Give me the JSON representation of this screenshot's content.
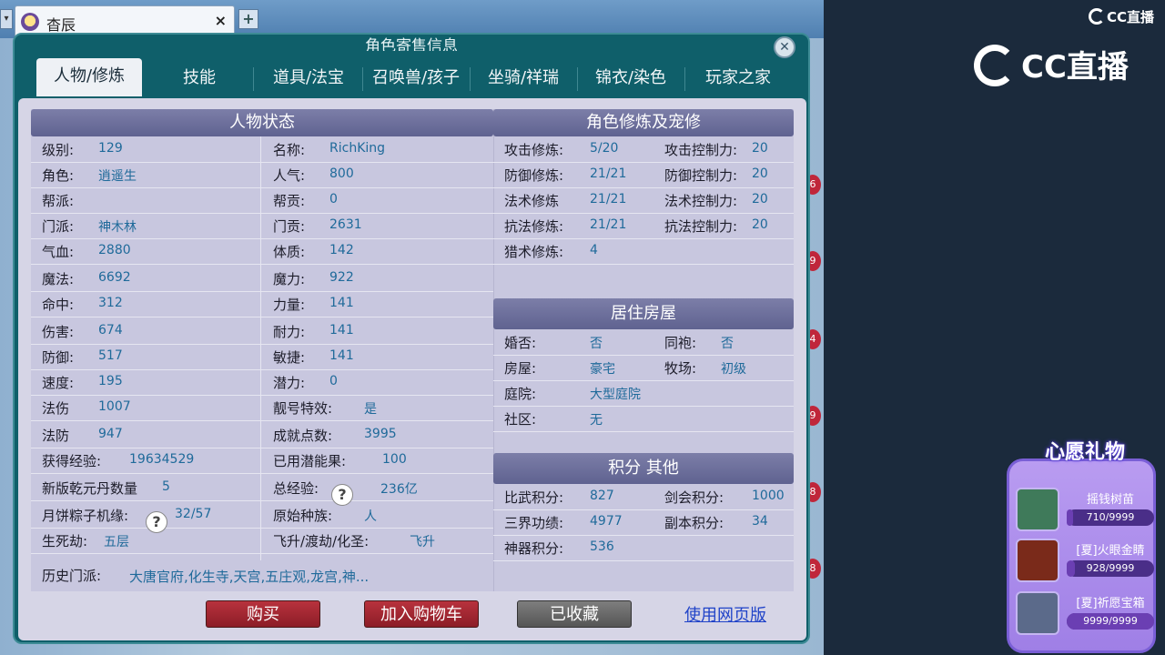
{
  "browser": {
    "tab_title": "杳辰",
    "tab_close": "×",
    "new_tab": "+",
    "tab_scroll": "▾"
  },
  "dialog": {
    "title": "角色寄售信息",
    "close": "✕",
    "tabs": [
      "人物/修炼",
      "技能",
      "道具/法宝",
      "召唤兽/孩子",
      "坐骑/祥瑞",
      "锦衣/染色",
      "玩家之家"
    ]
  },
  "status": {
    "heading": "人物状态",
    "left": [
      {
        "label": "级别:",
        "value": "129"
      },
      {
        "label": "角色:",
        "value": "逍遥生"
      },
      {
        "label": "帮派:",
        "value": ""
      },
      {
        "label": "门派:",
        "value": "神木林"
      },
      {
        "label": "气血:",
        "value": "2880"
      },
      {
        "label": "魔法:",
        "value": "6692"
      },
      {
        "label": "命中:",
        "value": "312"
      },
      {
        "label": "伤害:",
        "value": "674"
      },
      {
        "label": "防御:",
        "value": "517"
      },
      {
        "label": "速度:",
        "value": "195"
      },
      {
        "label": "法伤",
        "value": "1007"
      },
      {
        "label": "法防",
        "value": "947"
      },
      {
        "label": "获得经验:",
        "value": "19634529"
      },
      {
        "label": "新版乾元丹数量",
        "value": "5"
      },
      {
        "label": "月饼粽子机缘:",
        "value": "32/57"
      },
      {
        "label": "生死劫:",
        "value": "五层"
      }
    ],
    "right": [
      {
        "label": "名称:",
        "value": "RichKing"
      },
      {
        "label": "人气:",
        "value": "800"
      },
      {
        "label": "帮贡:",
        "value": "0"
      },
      {
        "label": "门贡:",
        "value": "2631"
      },
      {
        "label": "体质:",
        "value": "142"
      },
      {
        "label": "魔力:",
        "value": "922"
      },
      {
        "label": "力量:",
        "value": "141"
      },
      {
        "label": "耐力:",
        "value": "141"
      },
      {
        "label": "敏捷:",
        "value": "141"
      },
      {
        "label": "潜力:",
        "value": "0"
      },
      {
        "label": "靓号特效:",
        "value": "是"
      },
      {
        "label": "成就点数:",
        "value": "3995"
      },
      {
        "label": "已用潜能果:",
        "value": "100"
      },
      {
        "label": "总经验:",
        "value": "236亿"
      },
      {
        "label": "原始种族:",
        "value": "人"
      },
      {
        "label": "飞升/渡劫/化圣:",
        "value": "飞升"
      }
    ],
    "history_label": "历史门派:",
    "history_value": "大唐官府,化生寺,天宫,五庄观,龙宫,神..."
  },
  "cultivation": {
    "heading": "角色修炼及宠修",
    "rows": [
      {
        "l1": "攻击修炼:",
        "v1": "5/20",
        "l2": "攻击控制力:",
        "v2": "20"
      },
      {
        "l1": "防御修炼:",
        "v1": "21/21",
        "l2": "防御控制力:",
        "v2": "20"
      },
      {
        "l1": "法术修炼",
        "v1": "21/21",
        "l2": "法术控制力:",
        "v2": "20"
      },
      {
        "l1": "抗法修炼:",
        "v1": "21/21",
        "l2": "抗法控制力:",
        "v2": "20"
      },
      {
        "l1": "猎术修炼:",
        "v1": "4",
        "l2": "",
        "v2": ""
      }
    ]
  },
  "housing": {
    "heading": "居住房屋",
    "rows": [
      {
        "l1": "婚否:",
        "v1": "否",
        "l2": "同袍:",
        "v2": "否"
      },
      {
        "l1": "房屋:",
        "v1": "豪宅",
        "l2": "牧场:",
        "v2": "初级"
      },
      {
        "l1": "庭院:",
        "v1": "大型庭院",
        "l2": "",
        "v2": ""
      },
      {
        "l1": "社区:",
        "v1": "无",
        "l2": "",
        "v2": ""
      }
    ]
  },
  "points": {
    "heading": "积分 其他",
    "rows": [
      {
        "l1": "比武积分:",
        "v1": "827",
        "l2": "剑会积分:",
        "v2": "1000"
      },
      {
        "l1": "三界功绩:",
        "v1": "4977",
        "l2": "副本积分:",
        "v2": "34"
      },
      {
        "l1": "神器积分:",
        "v1": "536",
        "l2": "",
        "v2": ""
      }
    ]
  },
  "buttons": {
    "buy": "购买",
    "add_cart": "加入购物车",
    "favorited": "已收藏",
    "web_version": "使用网页版"
  },
  "help_mark": "?",
  "edge_badges": [
    "6",
    "9",
    "4",
    "9",
    "8",
    "8"
  ],
  "overlay": {
    "cc_small": "CC直播",
    "cc_logo": "CC直播",
    "wish_title": "心愿礼物",
    "gifts": [
      {
        "name": "摇钱树苗",
        "count": "710/9999",
        "progress": 0.071
      },
      {
        "name": "[夏]火眼金睛",
        "count": "928/9999",
        "progress": 0.093
      },
      {
        "name": "[夏]祈愿宝箱",
        "count": "9999/9999",
        "progress": 1.0
      }
    ]
  },
  "colors": {
    "dialog_frame": "#0f5f6a",
    "panel_bg": "#d6d5e6",
    "section_head": "#6a6c9a",
    "value_text": "#1f6a9a",
    "button_red": "#a32a34",
    "link_blue": "#2043c8",
    "stream_bg": "#1b2a3c",
    "wish_purple": "#a886ea"
  }
}
